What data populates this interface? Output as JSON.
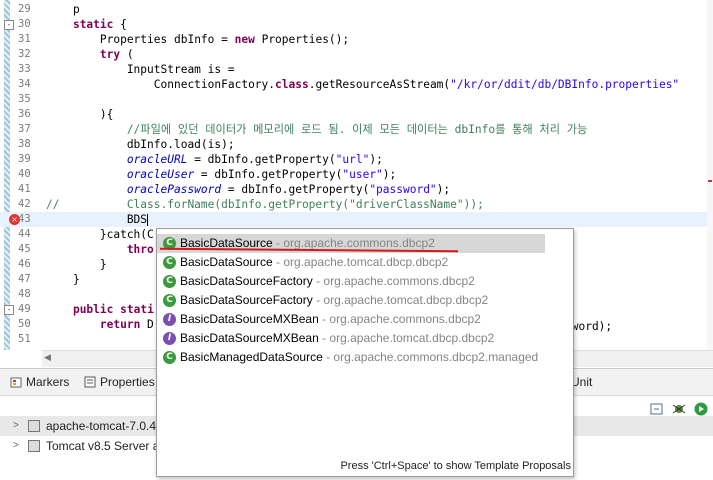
{
  "editor": {
    "lines": [
      {
        "n": "29",
        "segs": [
          {
            "t": "    p",
            "c": "plain"
          }
        ]
      },
      {
        "n": "30",
        "fold": "-",
        "segs": [
          {
            "t": "    ",
            "c": "plain"
          },
          {
            "t": "static",
            "c": "kw"
          },
          {
            "t": " {",
            "c": "plain"
          }
        ]
      },
      {
        "n": "31",
        "segs": [
          {
            "t": "        Properties ",
            "c": "plain"
          },
          {
            "t": "dbInfo",
            "c": "plain"
          },
          {
            "t": " = ",
            "c": "plain"
          },
          {
            "t": "new",
            "c": "kw"
          },
          {
            "t": " Properties();",
            "c": "plain"
          }
        ]
      },
      {
        "n": "32",
        "segs": [
          {
            "t": "        ",
            "c": "plain"
          },
          {
            "t": "try",
            "c": "kw"
          },
          {
            "t": " (",
            "c": "plain"
          }
        ]
      },
      {
        "n": "33",
        "segs": [
          {
            "t": "            InputStream is =",
            "c": "plain"
          }
        ]
      },
      {
        "n": "34",
        "segs": [
          {
            "t": "                ConnectionFactory.",
            "c": "plain"
          },
          {
            "t": "class",
            "c": "kw"
          },
          {
            "t": ".getResourceAsStream(",
            "c": "plain"
          },
          {
            "t": "\"/kr/or/ddit/db/DBInfo.properties\"",
            "c": "str"
          }
        ]
      },
      {
        "n": "35",
        "segs": []
      },
      {
        "n": "36",
        "segs": [
          {
            "t": "        ){",
            "c": "plain"
          }
        ]
      },
      {
        "n": "37",
        "segs": [
          {
            "t": "            //파일에 있던 데이터가 메모리에 로드 됨. 이제 모든 데이터는 dbInfo를 통해 처리 가능",
            "c": "cmt"
          }
        ]
      },
      {
        "n": "38",
        "segs": [
          {
            "t": "            dbInfo.load(is);",
            "c": "plain"
          }
        ]
      },
      {
        "n": "39",
        "segs": [
          {
            "t": "            ",
            "c": "plain"
          },
          {
            "t": "oracleURL",
            "c": "sfld"
          },
          {
            "t": " = dbInfo.getProperty(",
            "c": "plain"
          },
          {
            "t": "\"url\"",
            "c": "str"
          },
          {
            "t": ");",
            "c": "plain"
          }
        ]
      },
      {
        "n": "40",
        "segs": [
          {
            "t": "            ",
            "c": "plain"
          },
          {
            "t": "oracleUser",
            "c": "sfld"
          },
          {
            "t": " = dbInfo.getProperty(",
            "c": "plain"
          },
          {
            "t": "\"user\"",
            "c": "str"
          },
          {
            "t": ");",
            "c": "plain"
          }
        ]
      },
      {
        "n": "41",
        "segs": [
          {
            "t": "            ",
            "c": "plain"
          },
          {
            "t": "oraclePassword",
            "c": "sfld"
          },
          {
            "t": " = dbInfo.getProperty(",
            "c": "plain"
          },
          {
            "t": "\"password\"",
            "c": "str"
          },
          {
            "t": ");",
            "c": "plain"
          }
        ]
      },
      {
        "n": "42",
        "segs": [
          {
            "t": "//          Class.forName(dbInfo.getProperty(\"driverClassName\"));",
            "c": "cmt"
          }
        ]
      },
      {
        "n": "43",
        "err": "×",
        "current": true,
        "segs": [
          {
            "t": "            BDS",
            "c": "plain"
          }
        ]
      },
      {
        "n": "44",
        "segs": [
          {
            "t": "        }catch(C",
            "c": "plain"
          }
        ]
      },
      {
        "n": "45",
        "segs": [
          {
            "t": "            thro",
            "c": "kw"
          }
        ]
      },
      {
        "n": "46",
        "segs": [
          {
            "t": "        }",
            "c": "plain"
          }
        ]
      },
      {
        "n": "47",
        "segs": [
          {
            "t": "    }",
            "c": "plain"
          }
        ]
      },
      {
        "n": "48",
        "segs": []
      },
      {
        "n": "49",
        "fold": "-",
        "segs": [
          {
            "t": "    ",
            "c": "plain"
          },
          {
            "t": "public",
            "c": "kw"
          },
          {
            "t": " ",
            "c": "plain"
          },
          {
            "t": "stati",
            "c": "kw"
          }
        ]
      },
      {
        "n": "50",
        "segs": [
          {
            "t": "        ",
            "c": "plain"
          },
          {
            "t": "return",
            "c": "kw"
          },
          {
            "t": " D",
            "c": "plain"
          }
        ]
      },
      {
        "n": "51",
        "segs": []
      }
    ],
    "right_frag_50": "sword);"
  },
  "popup": {
    "proposals": [
      {
        "icon": "C",
        "kind": "cls",
        "name": "BasicDataSource",
        "pkg": " - org.apache.commons.dbcp2",
        "selected": true
      },
      {
        "icon": "C",
        "kind": "cls",
        "name": "BasicDataSource",
        "pkg": " - org.apache.tomcat.dbcp.dbcp2"
      },
      {
        "icon": "C",
        "kind": "cls",
        "name": "BasicDataSourceFactory",
        "pkg": " - org.apache.commons.dbcp2"
      },
      {
        "icon": "C",
        "kind": "cls",
        "name": "BasicDataSourceFactory",
        "pkg": " - org.apache.tomcat.dbcp.dbcp2"
      },
      {
        "icon": "I",
        "kind": "intf",
        "name": "BasicDataSourceMXBean",
        "pkg": " - org.apache.commons.dbcp2"
      },
      {
        "icon": "I",
        "kind": "intf",
        "name": "BasicDataSourceMXBean",
        "pkg": " - org.apache.tomcat.dbcp.dbcp2"
      },
      {
        "icon": "C",
        "kind": "cls",
        "name": "BasicManagedDataSource",
        "pkg": " - org.apache.commons.dbcp2.managed"
      }
    ],
    "footer": "Press 'Ctrl+Space' to show Template Proposals"
  },
  "bottom": {
    "tabs": {
      "markers": "Markers",
      "properties": "Properties",
      "unit": "Unit"
    },
    "servers": [
      {
        "label": "apache-tomcat-7.0.4"
      },
      {
        "label": "Tomcat v8.5 Server a"
      }
    ]
  }
}
